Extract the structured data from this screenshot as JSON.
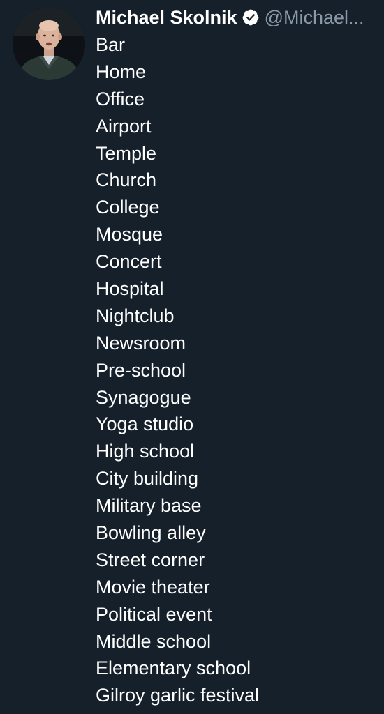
{
  "tweet": {
    "author": {
      "display_name": "Michael Skolnik",
      "handle": "@Michael...",
      "verified": true,
      "avatar_icon": "profile-photo"
    },
    "lines": [
      "Bar",
      "Home",
      "Office",
      "Airport",
      "Temple",
      "Church",
      "College",
      "Mosque",
      "Concert",
      "Hospital",
      "Nightclub",
      "Newsroom",
      "Pre-school",
      "Synagogue",
      "Yoga studio",
      "High school",
      "City building",
      "Military base",
      "Bowling alley",
      "Street corner",
      "Movie theater",
      "Political event",
      "Middle school",
      "Elementary school",
      "Gilroy garlic festival"
    ]
  },
  "colors": {
    "background": "#15202b",
    "text": "#ffffff",
    "handle": "#8b98a5",
    "verified_badge": "#ffffff"
  }
}
